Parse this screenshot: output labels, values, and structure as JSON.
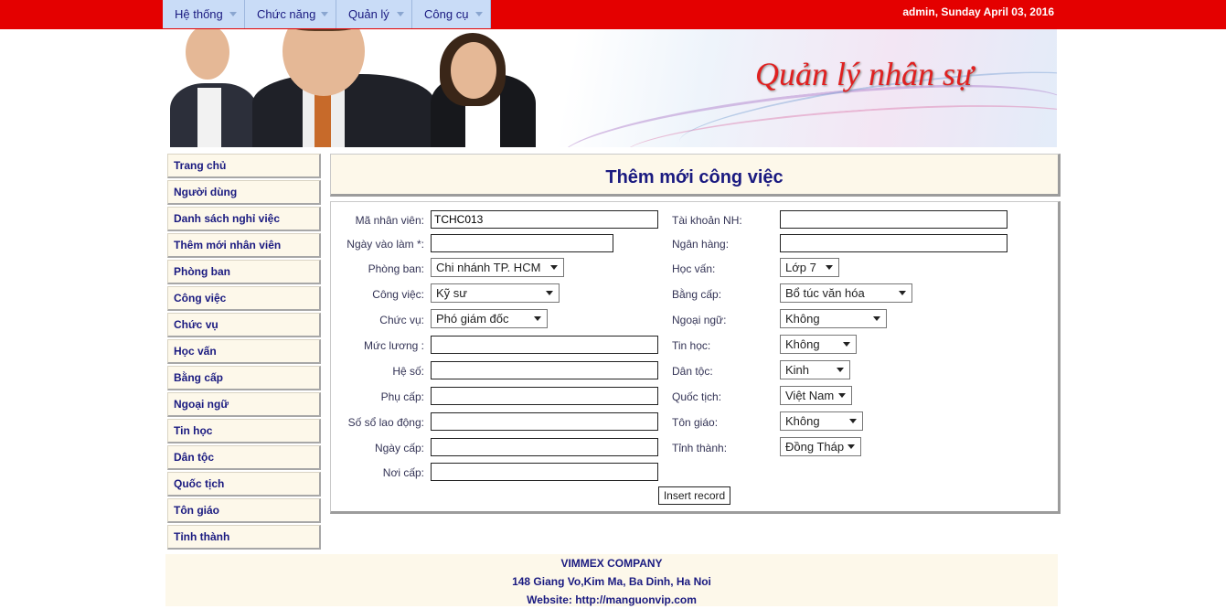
{
  "menu": [
    "Hệ thống",
    "Chức năng",
    "Quản lý",
    "Công cụ"
  ],
  "userinfo": "admin, Sunday April 03, 2016",
  "banner_title": "Quản lý nhân sự",
  "sidebar": [
    "Trang chủ",
    "Người dùng",
    "Danh sách nghỉ việc",
    "Thêm mới nhân viên",
    "Phòng ban",
    "Công việc",
    "Chức vụ",
    "Học vấn",
    "Bằng cấp",
    "Ngoại ngữ",
    "Tin học",
    "Dân tộc",
    "Quốc tịch",
    "Tôn giáo",
    "Tỉnh thành"
  ],
  "page_title": "Thêm mới công việc",
  "form": {
    "ma_nv": {
      "label": "Mã nhân viên:",
      "value": "TCHC013"
    },
    "ngay_vao_lam": {
      "label": "Ngày vào làm *:",
      "value": ""
    },
    "phong_ban": {
      "label": "Phòng ban:",
      "value": "Chi nhánh TP. HCM"
    },
    "cong_viec": {
      "label": "Công việc:",
      "value": "Kỹ sư"
    },
    "chuc_vu": {
      "label": "Chức vụ:",
      "value": "Phó giám đốc"
    },
    "muc_luong": {
      "label": "Mức lương :",
      "value": ""
    },
    "he_so": {
      "label": "Hệ số:",
      "value": ""
    },
    "phu_cap": {
      "label": "Phụ cấp:",
      "value": ""
    },
    "so_so_ld": {
      "label": "Số sổ lao động:",
      "value": ""
    },
    "ngay_cap": {
      "label": "Ngày cấp:",
      "value": ""
    },
    "noi_cap": {
      "label": "Nơi cấp:",
      "value": ""
    },
    "tai_khoan": {
      "label": "Tài khoản NH:",
      "value": ""
    },
    "ngan_hang": {
      "label": "Ngân hàng:",
      "value": ""
    },
    "hoc_van": {
      "label": "Học vấn:",
      "value": "Lớp 7"
    },
    "bang_cap": {
      "label": "Bằng cấp:",
      "value": "Bổ túc văn hóa"
    },
    "ngoai_ngu": {
      "label": "Ngoại ngữ:",
      "value": "Không"
    },
    "tin_hoc": {
      "label": "Tin học:",
      "value": "Không"
    },
    "dan_toc": {
      "label": "Dân tộc:",
      "value": "Kinh"
    },
    "quoc_tich": {
      "label": "Quốc tịch:",
      "value": "Việt Nam"
    },
    "ton_giao": {
      "label": "Tôn giáo:",
      "value": "Không"
    },
    "tinh_thanh": {
      "label": "Tỉnh thành:",
      "value": "Đồng Tháp"
    },
    "submit": "Insert record"
  },
  "footer": {
    "company": "VIMMEX COMPANY",
    "address": "148 Giang Vo,Kim Ma, Ba Dinh, Ha Noi",
    "website": "Website: http://manguonvip.com"
  },
  "colors": {
    "topbar": "#e40000",
    "menu_bg": "#c9dcf7",
    "nav_text": "#1a1a80",
    "panel_bg": "#fdf8ea"
  }
}
